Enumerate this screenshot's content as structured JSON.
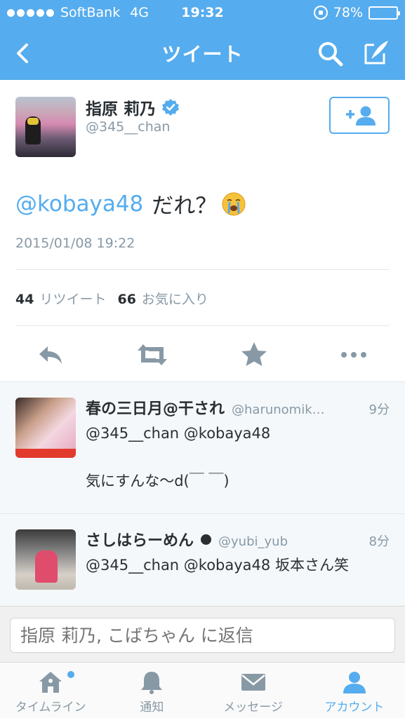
{
  "status_bar": {
    "carrier": "SoftBank",
    "network": "4G",
    "time": "19:32",
    "battery": "78%",
    "battery_level": 0.78,
    "icons": [
      "signal-dots-icon",
      "rotation-lock-icon",
      "battery-icon"
    ]
  },
  "nav": {
    "title": "ツイート",
    "icons": [
      "back-chevron-icon",
      "search-icon",
      "compose-icon"
    ]
  },
  "tweet": {
    "author_name": "指原 莉乃",
    "author_handle": "@345__chan",
    "verified": true,
    "mention": "@kobaya48",
    "text": "だれ？",
    "emoji": "crying-face-icon",
    "timestamp": "2015/01/08 19:22",
    "retweet_count": "44",
    "retweet_label": "リツイート",
    "favorite_count": "66",
    "favorite_label": "お気に入り",
    "actions": [
      "reply-icon",
      "retweet-icon",
      "favorite-star-icon",
      "more-icon"
    ]
  },
  "replies": [
    {
      "name": "春の三日月@干され",
      "handle": "@harunomik…",
      "time": "9分",
      "text": "@345__chan @kobaya48\n\n気にすんな〜d(￣ ￣)"
    },
    {
      "name": "さしはらーめん",
      "handle": "@yubi_yub",
      "time": "8分",
      "text": "@345__chan @kobaya48 坂本さん笑"
    }
  ],
  "composer": {
    "placeholder": "指原 莉乃, こばちゃん に返信"
  },
  "tabbar": {
    "items": [
      {
        "label": "タイムライン",
        "icon": "home-icon",
        "active": false
      },
      {
        "label": "通知",
        "icon": "bell-icon",
        "active": false
      },
      {
        "label": "メッセージ",
        "icon": "envelope-icon",
        "active": false
      },
      {
        "label": "アカウント",
        "icon": "person-icon",
        "active": true
      }
    ]
  },
  "colors": {
    "accent": "#55acee",
    "text": "#292f33",
    "muted": "#8899a6",
    "reply_bg": "#f5f8fa"
  }
}
